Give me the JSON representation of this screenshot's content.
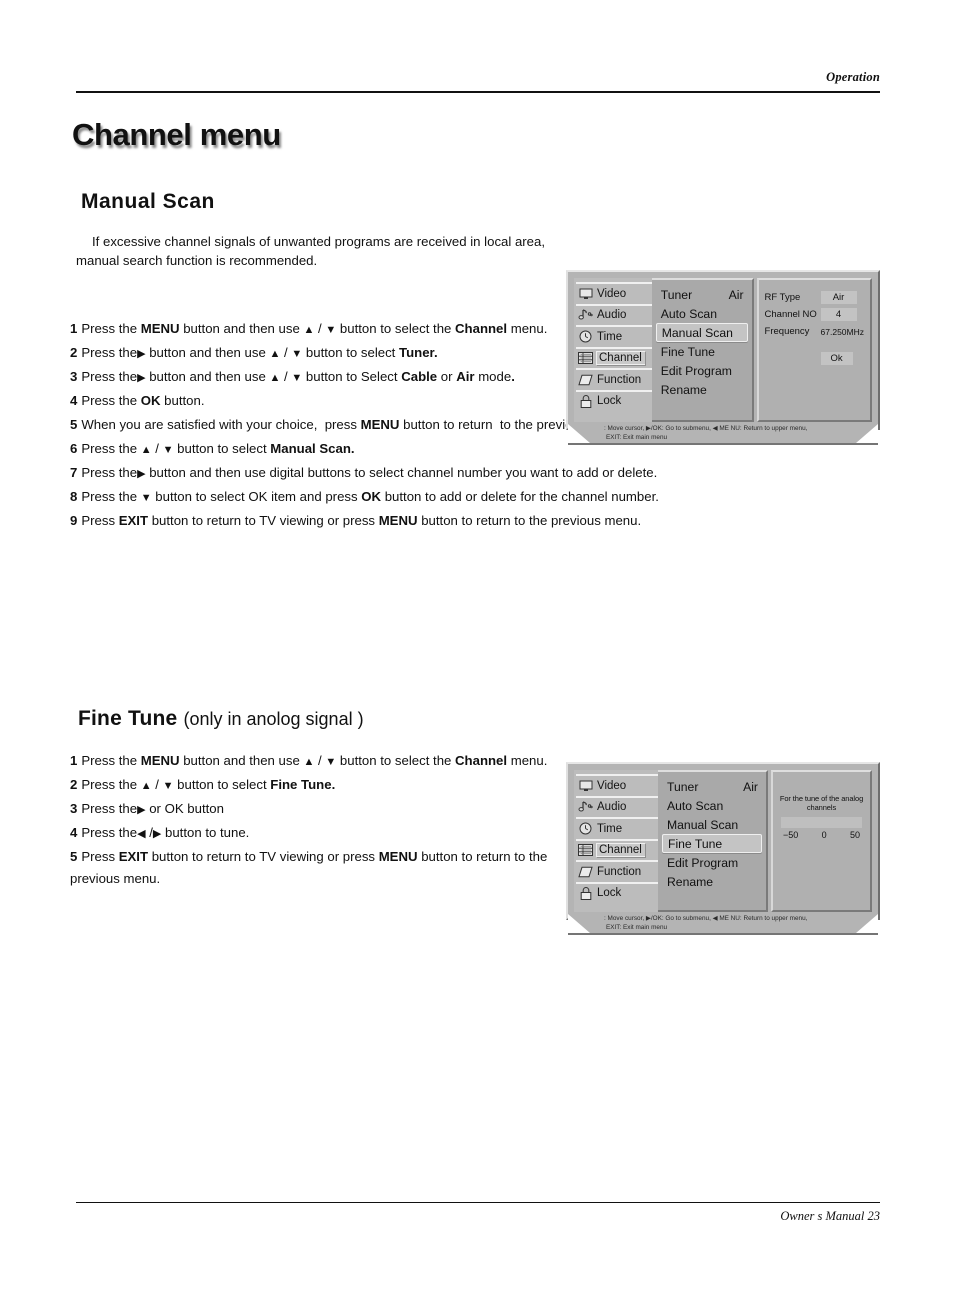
{
  "header": {
    "running_head": "Operation"
  },
  "footer": {
    "text": "Owner s Manual  23"
  },
  "page_title": "Channel menu",
  "manual_scan": {
    "title": "Manual Scan",
    "intro_line1": "If excessive channel signals of unwanted programs are received in local area,",
    "intro_line2": "manual search function is recommended.",
    "steps": [
      {
        "num": "1",
        "html": "Press the <b>MENU</b> button and then use <span class=\"arrow\">▲</span> / <span class=\"arrow\">▼</span> button to select the <b>Channel</b> menu."
      },
      {
        "num": "2",
        "html": "Press the<span class=\"arrow\">▶</span> button and then use <span class=\"arrow\">▲</span> / <span class=\"arrow\">▼</span> button to select <b>Tuner.</b>"
      },
      {
        "num": "3",
        "html": "Press the<span class=\"arrow\">▶</span> button and then use <span class=\"arrow\">▲</span> / <span class=\"arrow\">▼</span> button to Select <b>Cable</b> or <b>Air</b> mode<b>.</b>"
      },
      {
        "num": "4",
        "html": "Press the <b>OK</b> button."
      },
      {
        "num": "5",
        "html": "When you are satisfied with your choice,&nbsp; press <b>MENU</b> button to return&nbsp; to the previous menu."
      },
      {
        "num": "6",
        "html": "Press the <span class=\"arrow\">▲</span> / <span class=\"arrow\">▼</span> button to select<b> Manual Scan.</b>"
      },
      {
        "num": "7",
        "html": "Press the<span class=\"arrow\">▶</span> button and then use digital buttons to select channel number you want to add or delete."
      },
      {
        "num": "8",
        "html": "Press the <span class=\"arrow\">▼</span> button to select OK item and press <b>OK</b> button to add or delete for the channel number."
      },
      {
        "num": "9",
        "html": "Press <b>EXIT</b> button to return to TV viewing or press <b>MENU</b> button to return to the previous menu."
      }
    ]
  },
  "fine_tune": {
    "title_bold": "Fine Tune",
    "title_sub": "(only in anolog signal )",
    "steps": [
      {
        "num": "1",
        "html": "Press the <b>MENU</b> button and then use <span class=\"arrow\">▲</span> / <span class=\"arrow\">▼</span> button to select the <b>Channel</b> menu."
      },
      {
        "num": "2",
        "html": "Press the <span class=\"arrow\">▲</span> / <span class=\"arrow\">▼</span> button to select<b> Fine Tune.</b>"
      },
      {
        "num": "3",
        "html": "Press the<span class=\"arrow\">▶</span> or OK button"
      },
      {
        "num": "4",
        "html": "Press the<span class=\"arrow\">◀</span> /<span class=\"arrow\">▶</span> button to tune."
      },
      {
        "num": "5",
        "html": "Press <b>EXIT</b> button to return to TV viewing or press <b>MENU</b> button to return to the previous menu."
      }
    ]
  },
  "osd": {
    "nav_items": [
      {
        "label": "Video",
        "icon": "monitor-icon"
      },
      {
        "label": "Audio",
        "icon": "music-note-icon"
      },
      {
        "label": "Time",
        "icon": "clock-icon"
      },
      {
        "label": "Channel",
        "icon": "channel-grid-icon"
      },
      {
        "label": "Function",
        "icon": "diamond-icon"
      },
      {
        "label": "Lock",
        "icon": "padlock-icon"
      }
    ],
    "menu_items": [
      {
        "label": "Tuner",
        "value": "Air"
      },
      {
        "label": "Auto Scan",
        "value": ""
      },
      {
        "label": "Manual Scan",
        "value": ""
      },
      {
        "label": "Fine Tune",
        "value": ""
      },
      {
        "label": "Edit Program",
        "value": ""
      },
      {
        "label": "Rename",
        "value": ""
      }
    ],
    "help_line1": ": Move cursor,  ▶/OK: Go to submenu,  ◀ ME NU: Return to upper menu,",
    "help_line2": "EXIT: Exit main menu",
    "manual_scan_panel": {
      "selected_nav": "Channel",
      "selected_item": "Manual Scan",
      "rows": [
        {
          "label": "RF  Type",
          "value": "Air",
          "style": "chip"
        },
        {
          "label": "Channel NO",
          "value": "4",
          "style": "chip"
        },
        {
          "label": "Frequency",
          "value": "67.250MHz",
          "style": "plain"
        }
      ],
      "ok_label": "Ok"
    },
    "fine_tune_panel": {
      "selected_nav": "Channel",
      "selected_item": "Fine Tune",
      "caption": "For the tune of the analog channels",
      "scale_min": "−50",
      "scale_mid": "0",
      "scale_max": "50"
    }
  }
}
